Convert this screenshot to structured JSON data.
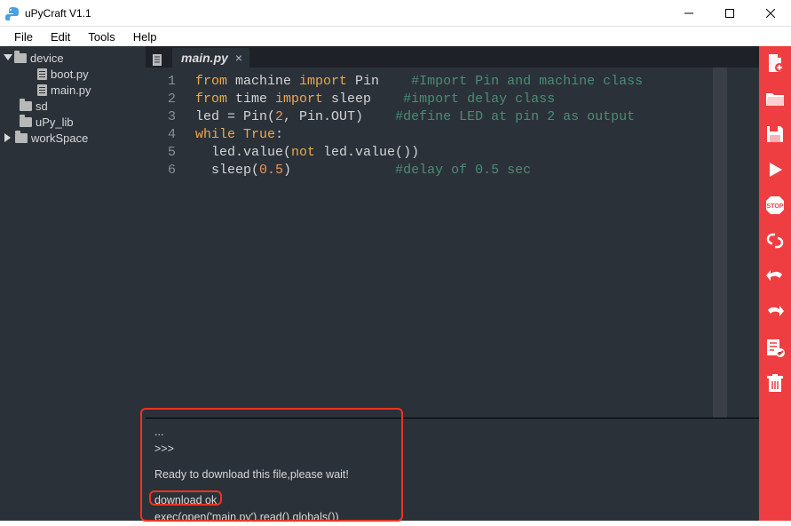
{
  "window": {
    "title": "uPyCraft V1.1"
  },
  "menu": {
    "file": "File",
    "edit": "Edit",
    "tools": "Tools",
    "help": "Help"
  },
  "tree": {
    "device": "device",
    "boot": "boot.py",
    "main": "main.py",
    "sd": "sd",
    "upylib": "uPy_lib",
    "workspace": "workSpace"
  },
  "tab": {
    "name": "main.py"
  },
  "lines": [
    "1",
    "2",
    "3",
    "4",
    "5",
    "6"
  ],
  "code": {
    "l1": {
      "a": "from",
      "b": " machine ",
      "c": "import",
      "d": " Pin    ",
      "e": "#Import Pin and machine class"
    },
    "l2": {
      "a": "from",
      "b": " time ",
      "c": "import",
      "d": " sleep    ",
      "e": "#import delay class"
    },
    "l3": {
      "a": "led = Pin(",
      "b": "2",
      "c": ", Pin.OUT)    ",
      "d": "#define LED at pin 2 as output"
    },
    "l4": {
      "a": "while",
      "b": " ",
      "c": "True",
      "d": ":"
    },
    "l5": {
      "a": "  led.value(",
      "b": "not",
      "c": " led.value())"
    },
    "l6": {
      "a": "  sleep(",
      "b": "0.5",
      "c": ")             ",
      "d": "#delay of 0.5 sec"
    }
  },
  "term": {
    "dots": "...",
    "prompt": ">>>",
    "msg1": "Ready to download this file,please wait!",
    "msg2": "download ok",
    "msg3": "exec(open('main.py').read(),globals())"
  },
  "colors": {
    "toolstrip": "#ef3e42",
    "bg": "#2b3139"
  }
}
